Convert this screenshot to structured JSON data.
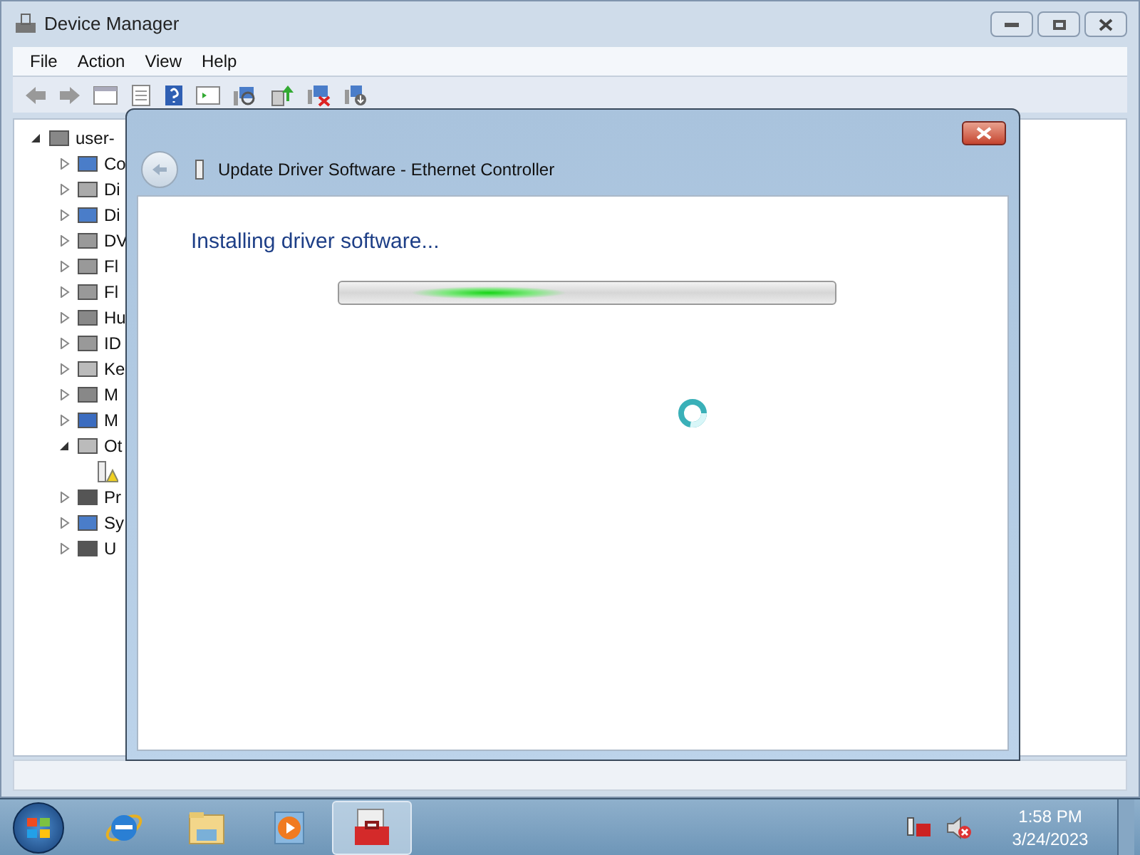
{
  "window": {
    "title": "Device Manager"
  },
  "menu": [
    "File",
    "Action",
    "View",
    "Help"
  ],
  "tree": {
    "label": "user-",
    "expanded": true,
    "children": [
      {
        "label": "Co",
        "expanded": false
      },
      {
        "label": "Di",
        "expanded": false
      },
      {
        "label": "Di",
        "expanded": false
      },
      {
        "label": "DV",
        "expanded": false
      },
      {
        "label": "Fl",
        "expanded": false
      },
      {
        "label": "Fl",
        "expanded": false
      },
      {
        "label": "Hu",
        "expanded": false
      },
      {
        "label": "ID",
        "expanded": false
      },
      {
        "label": "Ke",
        "expanded": false
      },
      {
        "label": "M",
        "expanded": false
      },
      {
        "label": "M",
        "expanded": false
      },
      {
        "label": "Ot",
        "expanded": true,
        "children": [
          {
            "warning": true
          }
        ]
      },
      {
        "label": "Pr",
        "expanded": false
      },
      {
        "label": "Sy",
        "expanded": false
      },
      {
        "label": "U",
        "expanded": false
      }
    ]
  },
  "dialog": {
    "title": "Update Driver Software - Ethernet Controller",
    "heading": "Installing driver software...",
    "progress": {
      "indeterminate": true
    }
  },
  "taskbar": {
    "apps": [
      {
        "kind": "browser",
        "selected": false
      },
      {
        "kind": "folder",
        "selected": false
      },
      {
        "kind": "media",
        "selected": false
      },
      {
        "kind": "toolbox",
        "selected": true
      }
    ]
  },
  "clock": {
    "time": "1:58 PM",
    "date": "3/24/2023"
  }
}
